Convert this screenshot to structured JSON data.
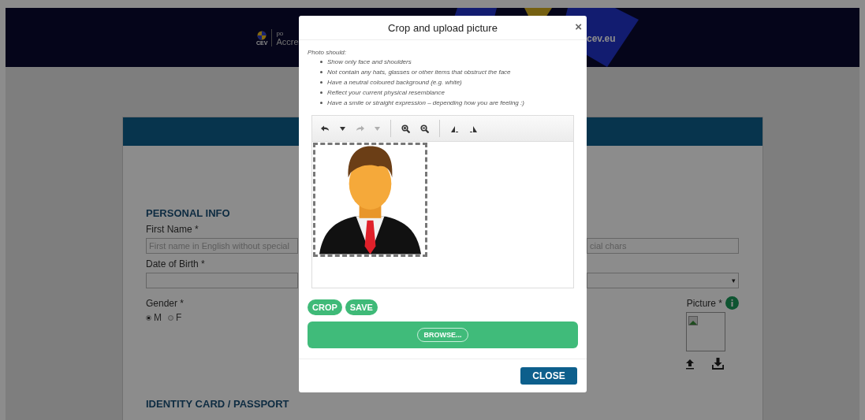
{
  "header": {
    "logo_text": "CEV",
    "tagline": "po",
    "site_name": "Accre",
    "domain": "cev.eu"
  },
  "form": {
    "section_title": "PERSONAL INFO",
    "first_name_label": "First Name *",
    "first_name_placeholder": "First name in English without special",
    "last_name_placeholder": "cial chars",
    "dob_label": "Date of Birth  *",
    "dropdown_caret": "▾",
    "gender_label": "Gender *",
    "gender_options": [
      {
        "label": "M",
        "selected": true
      },
      {
        "label": "F",
        "selected": false
      }
    ],
    "picture_label": "Picture *",
    "next_section_title": "IDENTITY CARD / PASSPORT"
  },
  "modal": {
    "title": "Crop and upload picture",
    "close_icon": "×",
    "intro": "Photo should:",
    "rules": [
      "Show only face and shoulders",
      "Not contain any hats, glasses or other items that obstruct the face",
      "Have a neutral coloured background (e.g. white)",
      "Reflect your current physical resemblance",
      "Have a smile or straight expression – depending how you are feeling :)"
    ],
    "toolbar": [
      [
        {
          "kind": "undo",
          "disabled": false
        },
        {
          "kind": "caret",
          "disabled": false
        },
        {
          "kind": "redo",
          "disabled": true
        },
        {
          "kind": "caret",
          "disabled": true
        }
      ],
      [
        {
          "kind": "zoom_in",
          "disabled": false
        },
        {
          "kind": "zoom_out",
          "disabled": false
        }
      ],
      [
        {
          "kind": "rotate_left",
          "disabled": false
        },
        {
          "kind": "rotate_right",
          "disabled": false
        }
      ]
    ],
    "crop_button": "CROP",
    "save_button": "SAVE",
    "browse_button": "BROWSE...",
    "close_button": "CLOSE"
  }
}
